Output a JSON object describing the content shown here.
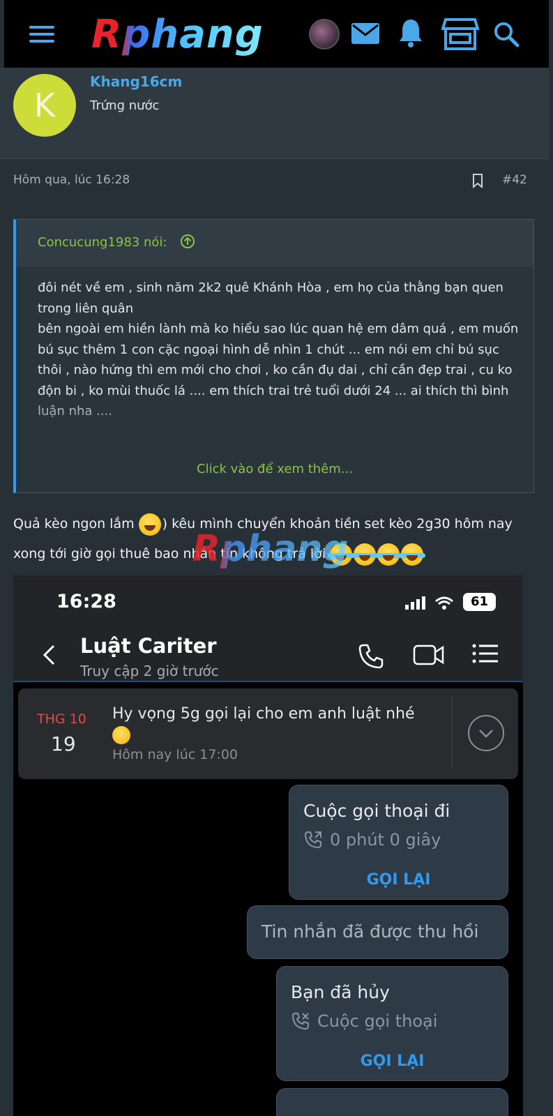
{
  "header": {
    "logo_text": "Rphang",
    "icons": [
      "menu-icon",
      "avatar",
      "mail-icon",
      "bell-icon",
      "store-icon",
      "search-icon"
    ],
    "accent": "#4aa8e8"
  },
  "post": {
    "author_initial": "K",
    "author": "Khang16cm",
    "author_title": "Trứng nước",
    "time": "Hôm qua, lúc 16:28",
    "number": "#42",
    "quote": {
      "author_label": "Concucung1983 nói:",
      "lines": [
        "đôi nét về em , sinh năm 2k2 quê Khánh Hòa , em họ của thằng bạn quen trong liên quân",
        "bên ngoài em hiền lành mà ko hiểu sao lúc quan hệ em dâm quá , em muốn bú sục thêm 1 con cặc ngoại hình dễ nhìn 1 chút ... em nói em chỉ bú sục thôi , nào hứng thì em mới cho chơi , ko cần đụ dai , chỉ cần đẹp trai , cu ko độn bi , ko mùi thuốc lá .... em thích trai trẻ tuổi dưới 24 ... ai thích thì bình luận nha ...."
      ],
      "expand_label": "Click vào để xem thêm..."
    },
    "message_part1": "Quả kèo ngon lắm ",
    "message_part2": ") kêu mình chuyển khoản tiền set kèo 2g30 hôm nay xong tới giờ gọi thuê bao nhắn tin không trả lời ",
    "watermark": "Rphang"
  },
  "screenshot": {
    "clock": "16:28",
    "battery": "61",
    "contact_name": "Luật Cariter",
    "contact_status": "Truy cập 2 giờ trước",
    "reminder": {
      "month": "THG 10",
      "day": "19",
      "text": "Hy vọng 5g gọi lại cho em anh luật nhé",
      "time": "Hôm nay lúc 17:00"
    },
    "bubbles": {
      "outgoing_call_title": "Cuộc gọi thoại đi",
      "outgoing_call_duration": "0 phút 0 giây",
      "callback_label": "GỌI LẠI",
      "recalled_message": "Tin nhắn đã được thu hồi",
      "cancelled_title": "Bạn đã hủy",
      "cancelled_sub": "Cuộc gọi thoại",
      "callback_label_2": "GỌI LẠI"
    }
  }
}
